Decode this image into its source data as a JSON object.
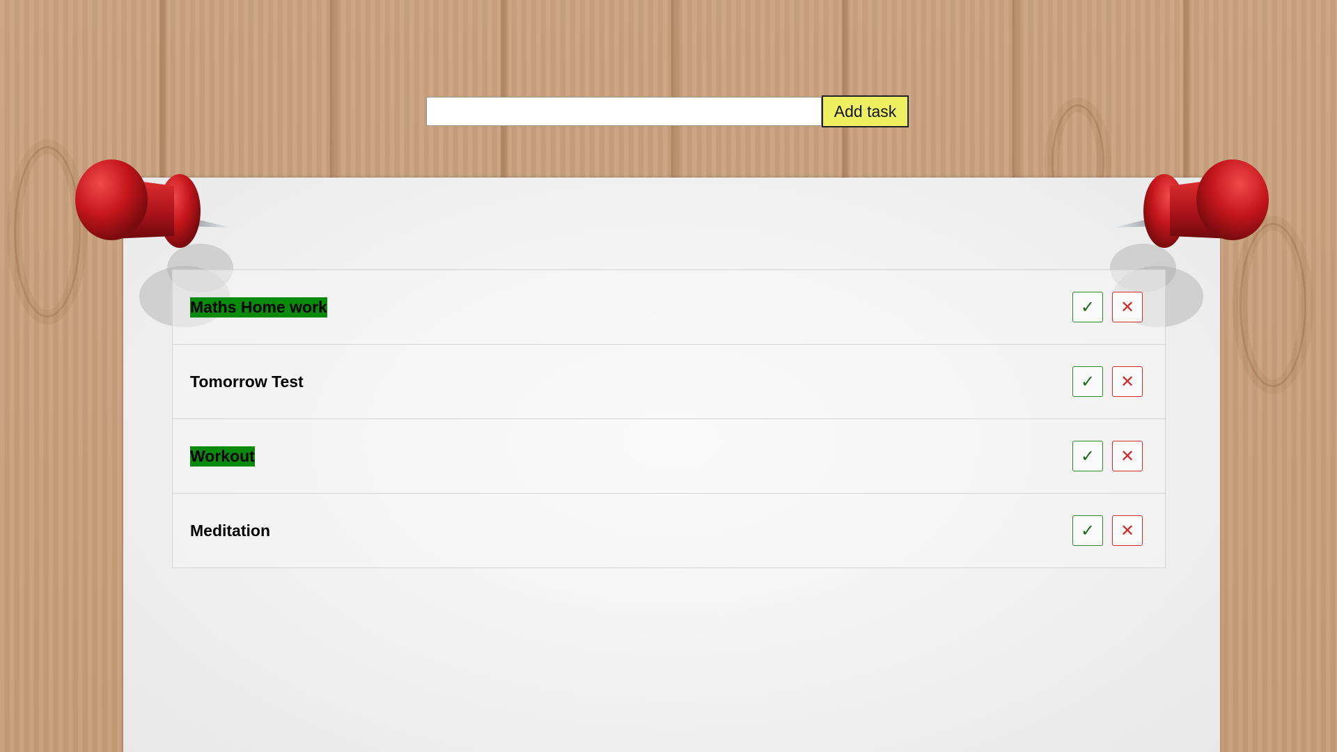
{
  "add_form": {
    "input_value": "",
    "input_placeholder": "",
    "add_button_label": "Add task"
  },
  "tasks": [
    {
      "text": "Maths Home work",
      "completed": true
    },
    {
      "text": "Tomorrow Test",
      "completed": false
    },
    {
      "text": "Workout",
      "completed": true
    },
    {
      "text": "Meditation",
      "completed": false
    }
  ],
  "actions": {
    "complete_symbol": "✓",
    "delete_symbol": "✕"
  },
  "colors": {
    "add_button_bg": "#eef062",
    "completed_highlight": "#0a8a0a",
    "complete_border": "#2a8a2a",
    "delete_border": "#d62b2b",
    "pin_red": "#c4161c"
  }
}
